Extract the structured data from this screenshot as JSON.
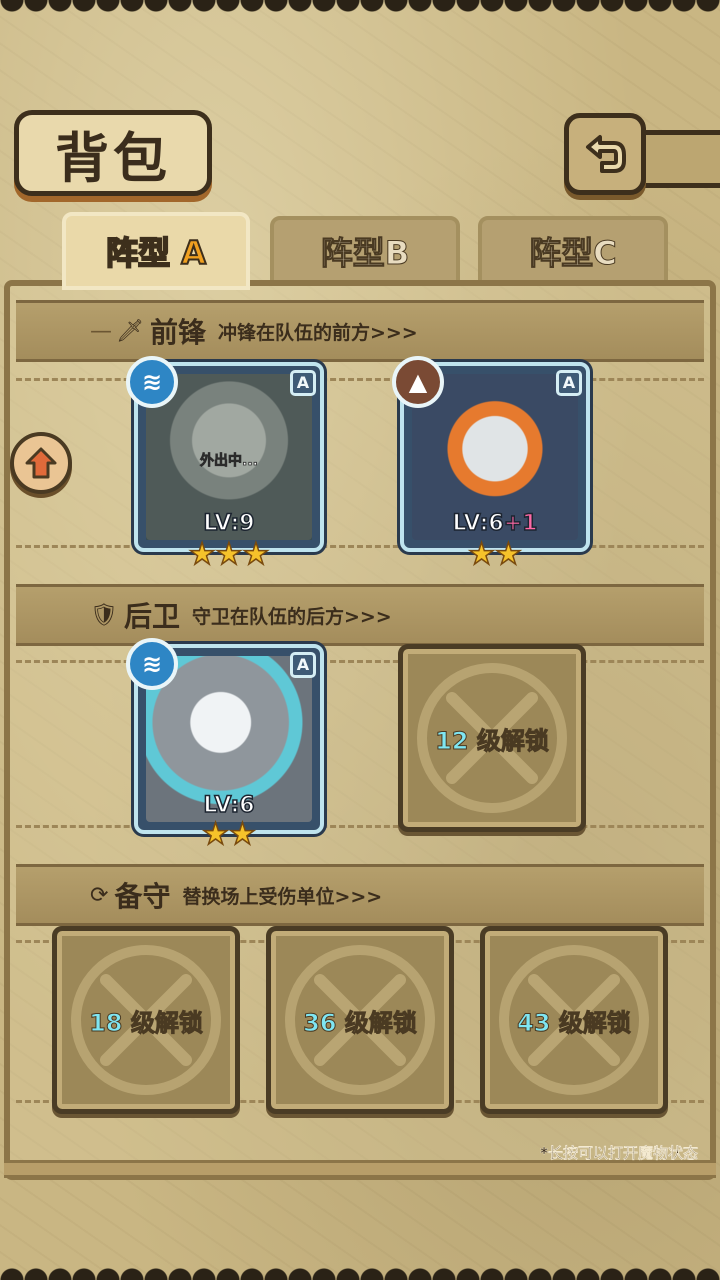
{
  "header": {
    "title": "背包",
    "back_icon": "back-arrow-icon"
  },
  "tabs": [
    {
      "label_main": "阵型",
      "label_letter": "A",
      "active": true
    },
    {
      "label_main": "阵型",
      "label_letter": "B",
      "active": false
    },
    {
      "label_main": "阵型",
      "label_letter": "C",
      "active": false
    }
  ],
  "sections": {
    "front": {
      "title": "前锋",
      "desc": "冲锋在队伍的前方>>>"
    },
    "back": {
      "title": "后卫",
      "desc": "守卫在队伍的后方>>>"
    },
    "reserve": {
      "title": "备守",
      "desc": "替换场上受伤单位>>>"
    }
  },
  "units": {
    "front_1": {
      "grade": "A",
      "element": "water",
      "status": "外出中...",
      "level": "LV:9",
      "stars": "★★★"
    },
    "front_2": {
      "grade": "A",
      "element": "earth",
      "level": "LV:6",
      "level_bonus": "+1",
      "stars": "★★"
    },
    "back_1": {
      "grade": "A",
      "element": "water",
      "level": "LV:6",
      "stars": "★★"
    }
  },
  "locked_slots": {
    "back_2": {
      "level": "12",
      "suffix": "级解锁"
    },
    "reserve_1": {
      "level": "18",
      "suffix": "级解锁"
    },
    "reserve_2": {
      "level": "36",
      "suffix": "级解锁"
    },
    "reserve_3": {
      "level": "43",
      "suffix": "级解锁"
    }
  },
  "hint": "*长按可以打开魔物状态",
  "colors": {
    "water": "#2e86c5",
    "earth": "#7a4a34",
    "lock_number": "#7fe6f2",
    "star": "#f6c22a",
    "bonus": "#ff69a6"
  }
}
